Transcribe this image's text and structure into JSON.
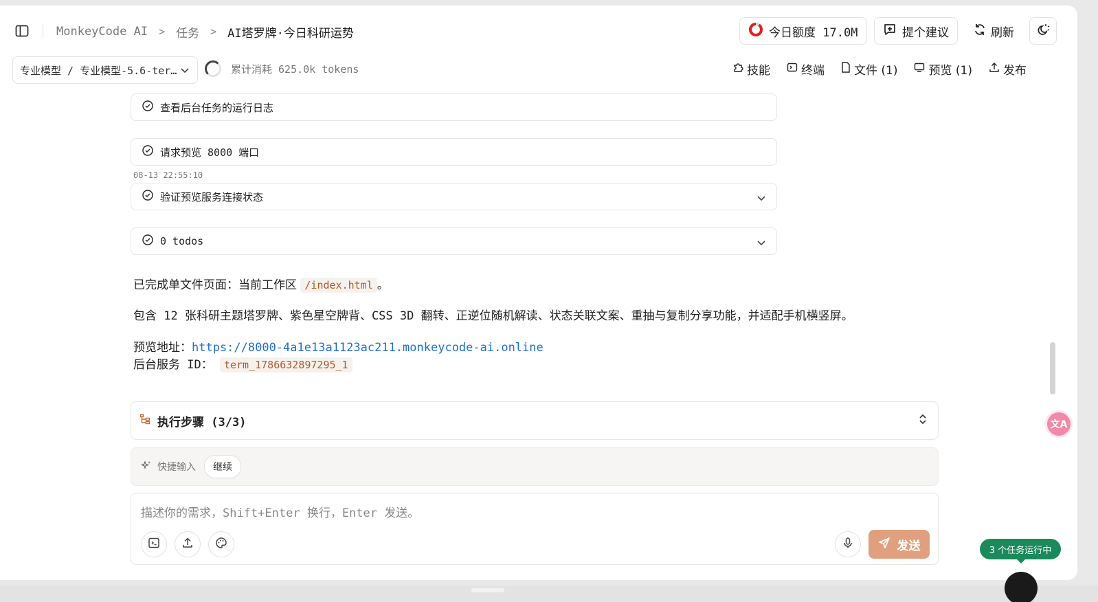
{
  "header": {
    "breadcrumb": [
      "MonkeyCode AI",
      "任务",
      "AI塔罗牌·今日科研运势"
    ],
    "quota_label": "今日额度 17.0M",
    "suggest_label": "提个建议",
    "refresh_label": "刷新"
  },
  "toolbar": {
    "model_label": "专业模型 / 专业模型-5.6-ter…",
    "tokens_label": "累计消耗 625.0k tokens",
    "tools": [
      "技能",
      "终端",
      "文件 (1)",
      "预览 (1)",
      "发布"
    ]
  },
  "steps": [
    {
      "label": "查看后台任务的运行日志"
    },
    {
      "label": "请求预览 8000 端口"
    },
    {
      "label": "验证预览服务连接状态"
    },
    {
      "label": "0 todos"
    }
  ],
  "timestamp": "08-13 22:55:10",
  "message": {
    "line1_prefix": "已完成单文件页面：当前工作区",
    "line1_code": "/index.html",
    "line1_suffix": "。",
    "line2": "包含 12 张科研主题塔罗牌、紫色星空牌背、CSS 3D 翻转、正逆位随机解读、状态关联文案、重抽与复制分享功能，并适配手机横竖屏。",
    "preview_prefix": "预览地址：",
    "preview_url": "https://8000-4a1e13a1123ac211.monkeycode-ai.online",
    "service_prefix": "后台服务 ID：",
    "service_id": "term_1786632897295_1"
  },
  "exec_steps_label": "执行步骤 (3/3)",
  "quick_input": {
    "label": "快捷输入",
    "chip": "继续"
  },
  "composer": {
    "placeholder": "描述你的需求，Shift+Enter 换行，Enter 发送。",
    "send_label": "发送"
  },
  "running_badge": "3 个任务运行中",
  "translate_badge": "文A",
  "colors": {
    "accent": "#e0a07f",
    "link": "#1f6fd0",
    "running": "#1a8a5a",
    "code": "#b8572a",
    "quota_ring": "#e02020"
  }
}
